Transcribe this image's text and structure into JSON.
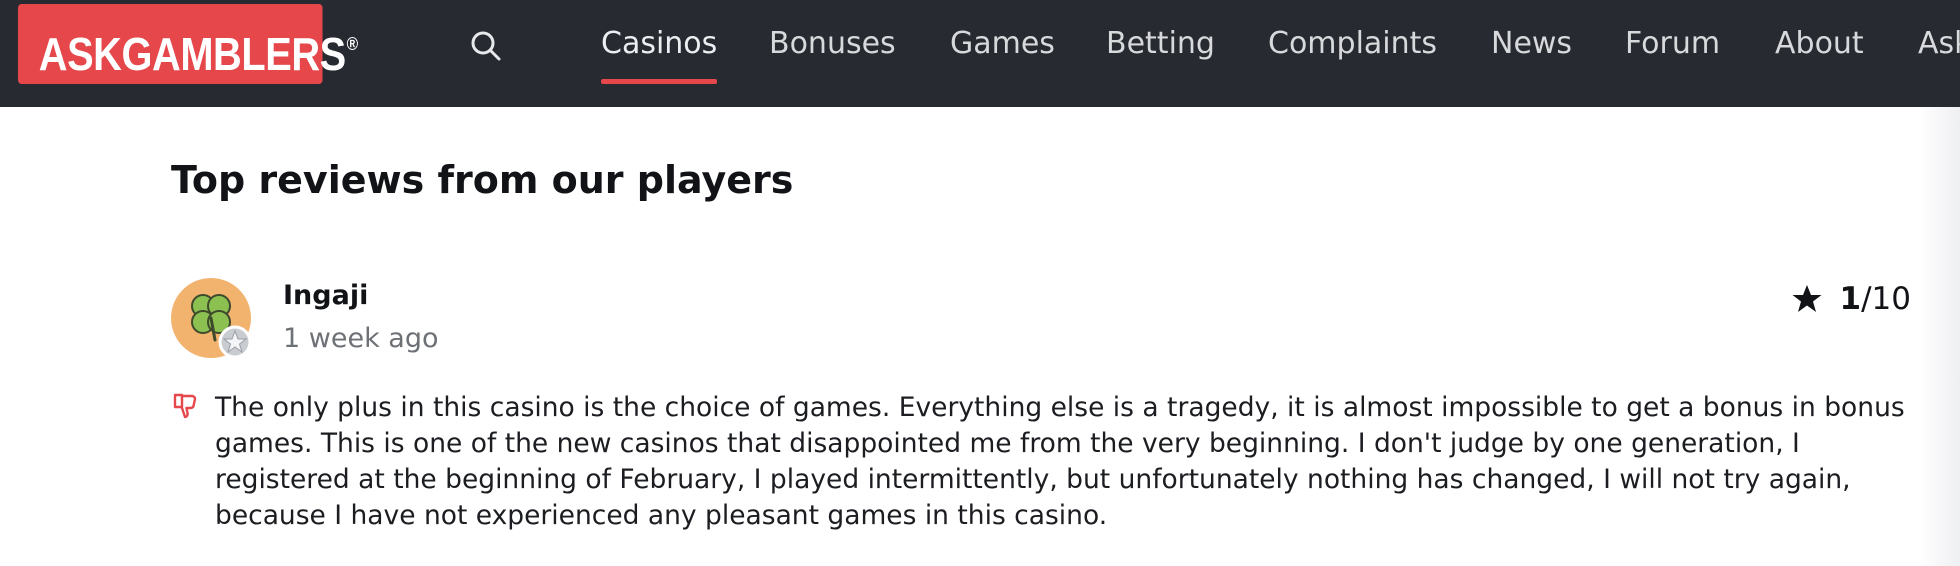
{
  "header": {
    "logo_text": "ASKGAMBLERS",
    "logo_mark": "®",
    "search_icon": "search-icon",
    "nav": [
      {
        "label": "Casinos",
        "active": true
      },
      {
        "label": "Bonuses",
        "active": false
      },
      {
        "label": "Games",
        "active": false
      },
      {
        "label": "Betting",
        "active": false
      },
      {
        "label": "Complaints",
        "active": false
      },
      {
        "label": "News",
        "active": false
      },
      {
        "label": "Forum",
        "active": false
      },
      {
        "label": "About",
        "active": false
      },
      {
        "label": "Ask",
        "active": false
      }
    ]
  },
  "main": {
    "title": "Top reviews from our players",
    "review": {
      "avatar_icon": "four-leaf-clover-icon",
      "badge_icon": "star-rank-badge-icon",
      "username": "Ingaji",
      "time_ago": "1 week ago",
      "rating_icon": "star-icon",
      "rating_score": "1",
      "rating_max": "/10",
      "sentiment_icon": "thumbs-down-icon",
      "text": "The only plus in this casino is the choice of games. Everything else is a tragedy, it is almost impossible to get a bonus in bonus games. This is one of the new casinos that disappointed me from the very beginning. I don't judge by one generation, I registered at the beginning of February, I played intermittently, but unfortunately nothing has changed, I will not try again, because I have not experienced any pleasant games in this casino."
    }
  },
  "colors": {
    "brand_red": "#e5474b",
    "header_bg": "#272a30",
    "avatar_bg": "#f2b36f",
    "clover_green": "#8cc152"
  }
}
